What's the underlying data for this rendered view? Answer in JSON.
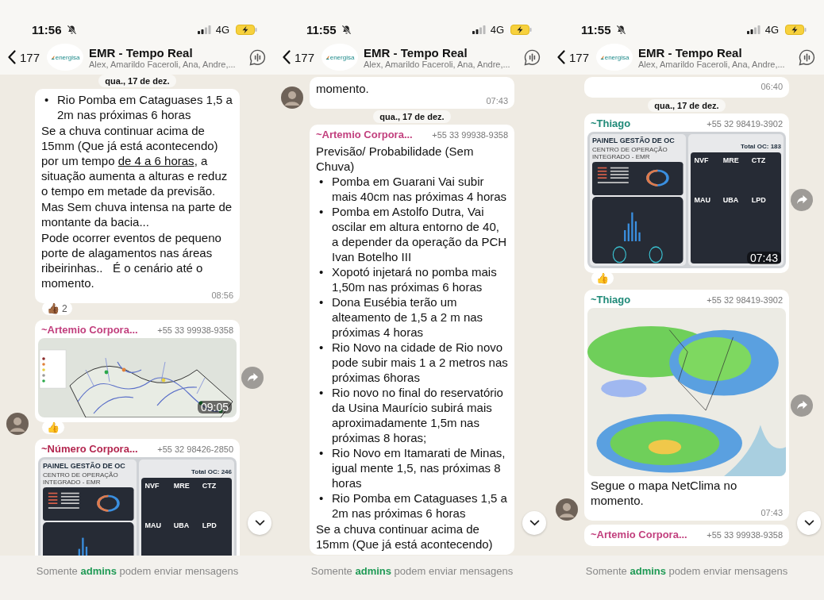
{
  "panels": [
    {
      "status": {
        "time": "11:56",
        "network": "4G"
      },
      "header": {
        "back_count": "177",
        "logo": "energisa",
        "title": "EMR - Tempo Real",
        "members": "Alex, Amarildo Faceroli, Ana, Andre,..."
      },
      "messages": [
        {
          "kind": "date",
          "text": "qua., 17 de dez."
        },
        {
          "kind": "message",
          "blocks": [
            {
              "kind": "bullets",
              "marker": "•",
              "items": [
                "Rio Pomba em Cataguases 1,5 a 2m nas próximas 6 horas"
              ]
            },
            {
              "kind": "linked",
              "before": "Se a chuva continuar acima de 15mm (Que já está acontecendo) por um tempo ",
              "link": "de 4 a 6 horas",
              "after": ", a situação aumenta a alturas e reduz o tempo em metade da previsão."
            },
            {
              "kind": "para",
              "text": "Mas Sem chuva intensa na parte de montante da bacia..."
            },
            {
              "kind": "para",
              "text": "Pode ocorrer eventos de pequeno porte de alagamentos nas áreas ribeirinhas..   É o cenário até o momento."
            }
          ],
          "time": "08:56",
          "reaction": {
            "emoji": "👍🏾",
            "count": "2"
          }
        },
        {
          "kind": "message",
          "sender": "~Artemio Corpora...",
          "phone": "+55 33 99938-9358",
          "color": "#c2407e",
          "image": {
            "kind": "river_map"
          },
          "time": "09:05",
          "avatar": true,
          "forward": true,
          "reaction": {
            "emoji": "👍"
          }
        },
        {
          "kind": "message",
          "sender": "~Número Corpora...",
          "phone": "+55 32 98426-2850",
          "color": "#b3264f",
          "image": {
            "kind": "dashboard",
            "title": "PAINEL GESTÃO DE OC",
            "subtitle": "CENTRO DE OPERAÇÃO INTEGRADO - EMR",
            "total": "Total OC: 246",
            "sections": [
              "NVF",
              "MRE",
              "CTZ",
              "MAU",
              "UBA",
              "LPD"
            ]
          }
        }
      ],
      "footer": {
        "before": "Somente",
        "link": "admins",
        "after": "podem enviar mensagens"
      }
    },
    {
      "status": {
        "time": "11:55",
        "network": "4G"
      },
      "header": {
        "back_count": "177",
        "logo": "energisa",
        "title": "EMR - Tempo Real",
        "members": "Alex, Amarildo Faceroli, Ana, Andre,..."
      },
      "messages": [
        {
          "kind": "message",
          "avatar": true,
          "blocks": [
            {
              "kind": "para",
              "text": "momento."
            }
          ],
          "time": "07:43"
        },
        {
          "kind": "date",
          "text": "qua., 17 de dez."
        },
        {
          "kind": "message",
          "sender": "~Artemio Corpora...",
          "phone": "+55 33 99938-9358",
          "color": "#c2407e",
          "blocks": [
            {
              "kind": "para",
              "text": "Previsão/ Probabilidade (Sem Chuva)"
            },
            {
              "kind": "bullets",
              "marker": "•",
              "items": [
                "Pomba em Guarani Vai subir mais 40cm nas próximas 4 horas",
                "Pomba em Astolfo Dutra, Vai oscilar em altura entorno de 40, a depender da operação da PCH Ivan Botelho III",
                "Xopotó injetará no pomba mais 1,50m nas próximas 6 horas",
                "Dona Eusébia terão um alteamento de 1,5 a 2 m nas próximas 4 horas",
                "Rio Novo na cidade de Rio novo pode subir mais 1 a 2 metros nas próximas 6horas",
                "Rio novo no final do reservatório da Usina Maurício subirá mais aproximadamente 1,5m nas próximas 8 horas;",
                "Rio Novo em Itamarati de Minas, igual mente 1,5, nas próximas 8 horas",
                "Rio Pomba em Cataguases 1,5 a 2m nas próximas 6 horas"
              ]
            },
            {
              "kind": "para",
              "text": "Se a chuva continuar acima de 15mm (Que já está acontecendo)"
            }
          ]
        }
      ],
      "footer": {
        "before": "Somente",
        "link": "admins",
        "after": "podem enviar mensagens"
      }
    },
    {
      "status": {
        "time": "11:55",
        "network": "4G"
      },
      "header": {
        "back_count": "177",
        "logo": "energisa",
        "title": "EMR - Tempo Real",
        "members": "Alex, Amarildo Faceroli, Ana, Andre,..."
      },
      "messages": [
        {
          "kind": "message",
          "time": "06:40"
        },
        {
          "kind": "date",
          "text": "qua., 17 de dez."
        },
        {
          "kind": "message",
          "sender": "~Thiago",
          "phone": "+55 32 98419-3902",
          "color": "#1f8a78",
          "image": {
            "kind": "dashboard",
            "title": "PAINEL GESTÃO DE OC",
            "subtitle": "CENTRO DE OPERAÇÃO INTEGRADO - EMR",
            "total": "Total OC: 183",
            "sections": [
              "NVF",
              "MRE",
              "CTZ",
              "MAU",
              "UBA",
              "LPD"
            ]
          },
          "time": "07:43",
          "forward": true,
          "reaction": {
            "emoji": "👍"
          }
        },
        {
          "kind": "message",
          "sender": "~Thiago",
          "phone": "+55 32 98419-3902",
          "color": "#1f8a78",
          "image": {
            "kind": "radar_map"
          },
          "blocks": [
            {
              "kind": "para",
              "text": "Segue o mapa NetClima no momento."
            }
          ],
          "time": "07:43",
          "avatar": true,
          "forward": true
        },
        {
          "kind": "message",
          "sender": "~Artemio Corpora...",
          "phone": "+55 33 99938-9358",
          "color": "#c2407e"
        }
      ],
      "footer": {
        "before": "Somente",
        "link": "admins",
        "after": "podem enviar mensagens"
      }
    }
  ]
}
